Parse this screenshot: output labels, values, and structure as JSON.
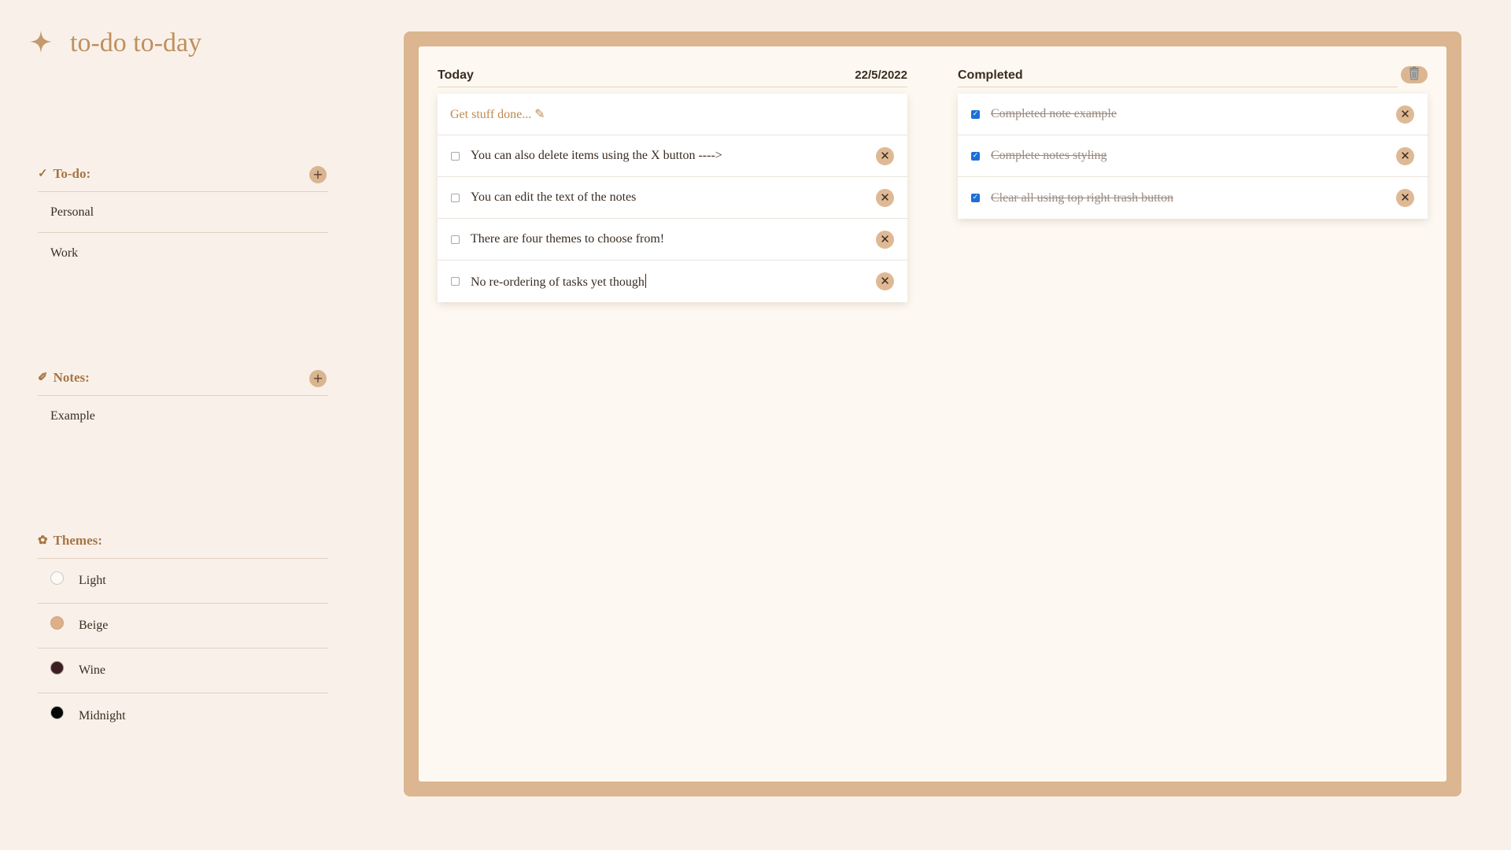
{
  "app": {
    "title": "to-do to-day",
    "logo_icon": "four-point-star-icon"
  },
  "sidebar": {
    "todo": {
      "icon": "✓",
      "label": "To-do:",
      "add_label": "+",
      "items": [
        {
          "label": "Personal"
        },
        {
          "label": "Work"
        }
      ]
    },
    "notes": {
      "icon": "✐",
      "label": "Notes:",
      "add_label": "+",
      "items": [
        {
          "label": "Example"
        }
      ]
    },
    "themes": {
      "icon": "✿",
      "label": "Themes:",
      "items": [
        {
          "label": "Light",
          "color": "#fdfaf6",
          "border": "#c9c9c9"
        },
        {
          "label": "Beige",
          "color": "#dcb08a",
          "border": "#cfa37c"
        },
        {
          "label": "Wine",
          "color": "#3b1e22",
          "border": "#9a8a8a"
        },
        {
          "label": "Midnight",
          "color": "#050505",
          "border": "#bdbdbd"
        }
      ]
    }
  },
  "today": {
    "header": "Today",
    "date": "22/5/2022",
    "new_placeholder": "Get stuff done... ✎",
    "tasks": [
      {
        "text": "You can also delete items using the X button ---->",
        "done": false
      },
      {
        "text": "You can edit the text of the notes",
        "done": false
      },
      {
        "text": "There are four themes to choose from!",
        "done": false
      },
      {
        "text": "No re-ordering of tasks yet though",
        "done": false
      }
    ]
  },
  "completed": {
    "header": "Completed",
    "clear_icon": "trash-icon",
    "tasks": [
      {
        "text": "Completed note example",
        "done": true
      },
      {
        "text": "Complete notes styling",
        "done": true
      },
      {
        "text": "Clear all using top right trash button",
        "done": true
      }
    ]
  },
  "remove_label": "✕",
  "check_mark": "✓",
  "colors": {
    "background": "#f9f1e9",
    "accent": "#dbb690",
    "board": "#fdf9f2",
    "heading": "#a87545",
    "checkbox_checked": "#1c6fd6"
  }
}
